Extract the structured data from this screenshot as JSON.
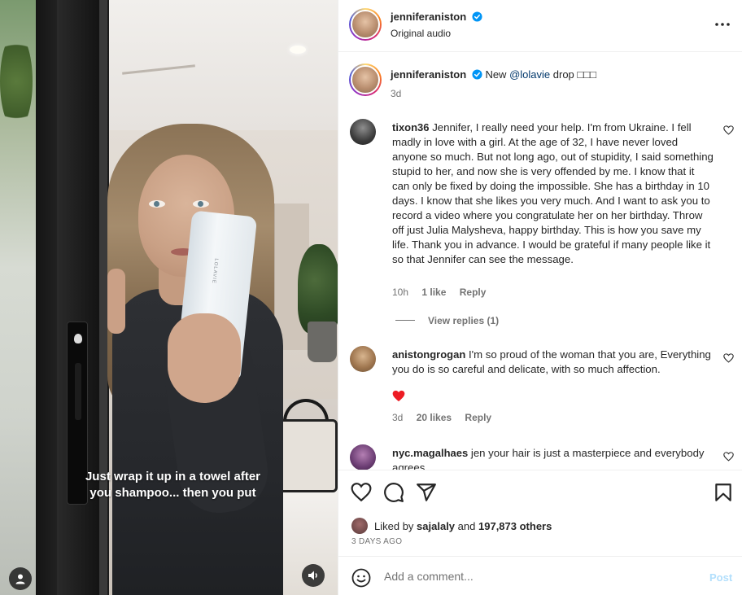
{
  "header": {
    "username": "jenniferaniston",
    "audio": "Original audio",
    "more_icon": "more-options-icon"
  },
  "media": {
    "caption_overlay": "Just wrap it up in a towel after you shampoo... then you put",
    "tube_brand": "LOLAVIE"
  },
  "post_caption": {
    "username": "jenniferaniston",
    "text_before": "New",
    "mention": "@lolavie",
    "text_after": "drop □□□",
    "time": "3d"
  },
  "comments": [
    {
      "username": "tixon36",
      "text": "Jennifer, I really need your help. I'm from Ukraine. I fell madly in love with a girl. At the age of 32, I have never loved anyone so much. But not long ago, out of stupidity, I said something stupid to her, and now she is very offended by me. I know that it can only be fixed by doing the impossible. She has a birthday in 10 days. I know that she likes you very much. And I want to ask you to record a video where you congratulate her on her birthday. Throw off just Julia Malysheva, happy birthday. This is how you save my life. Thank you in advance. I would be grateful if many people like it so that Jennifer can see the message.",
      "time": "10h",
      "likes": "1 like",
      "reply": "Reply",
      "view_replies": "View replies (1)"
    },
    {
      "username": "anistongrogan",
      "text": "I'm so proud of the woman that you are, Everything you do is so careful and delicate, with so much affection.",
      "emoji": "❤️",
      "time": "3d",
      "likes": "20 likes",
      "reply": "Reply"
    },
    {
      "username": "nyc.magalhaes",
      "text": "jen your hair is just a masterpiece and everybody agrees"
    }
  ],
  "actions": {
    "liked_by_prefix": "Liked by",
    "liked_by_user": "sajalaly",
    "liked_by_and": "and",
    "liked_by_others": "197,873 others",
    "date": "3 DAYS AGO"
  },
  "comment_box": {
    "placeholder": "Add a comment...",
    "post_label": "Post"
  },
  "colors": {
    "verified": "#0095f6",
    "link": "#00376b",
    "muted": "#737373",
    "post_disabled": "#b2dffc",
    "heart_red": "#ed1c24"
  }
}
